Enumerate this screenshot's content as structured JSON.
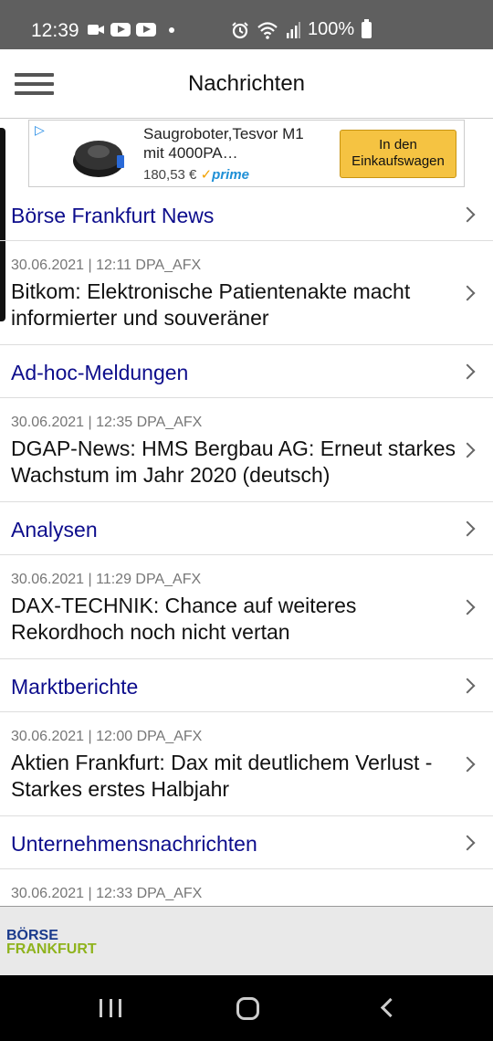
{
  "status_bar": {
    "time": "12:39",
    "battery": "100%"
  },
  "app_bar": {
    "title": "Nachrichten"
  },
  "ad": {
    "product_name": "Saugroboter,Tesvor M1 mit 4000PA…",
    "price": "180,53 €",
    "prime_label": "prime",
    "cart_button": "In den Einkaufswagen"
  },
  "feed": [
    {
      "section": "Börse Frankfurt News",
      "article": {
        "meta": "30.06.2021 | 12:11  DPA_AFX",
        "headline": "Bitkom: Elektronische Patientenakte macht informierter und souveräner"
      }
    },
    {
      "section": "Ad-hoc-Meldungen",
      "article": {
        "meta": "30.06.2021 | 12:35  DPA_AFX",
        "headline": "DGAP-News: HMS Bergbau AG: Erneut starkes Wachstum im Jahr 2020 (deutsch)"
      }
    },
    {
      "section": "Analysen",
      "article": {
        "meta": "30.06.2021 | 11:29  DPA_AFX",
        "headline": "DAX-TECHNIK: Chance auf weiteres Rekordhoch noch nicht vertan"
      }
    },
    {
      "section": "Marktberichte",
      "article": {
        "meta": "30.06.2021 | 12:00  DPA_AFX",
        "headline": "Aktien Frankfurt: Dax mit deutlichem Verlust - Starkes erstes Halbjahr"
      }
    },
    {
      "section": "Unternehmensnachrichten",
      "article": {
        "meta": "30.06.2021 | 12:33  DPA_AFX",
        "headline": ""
      }
    }
  ],
  "footer": {
    "logo_line1": "BÖRSE",
    "logo_line2": "FRANKFURT"
  },
  "colors": {
    "section_link": "#0d0d8c",
    "cart_button": "#f5c342",
    "logo_blue": "#1a3a8c",
    "logo_green": "#8fb31d"
  }
}
